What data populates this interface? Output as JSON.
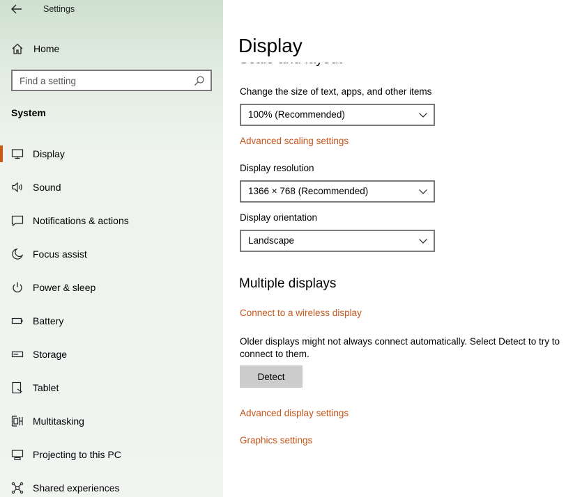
{
  "window": {
    "title": "Settings",
    "back_icon": "back-arrow-icon"
  },
  "sidebar": {
    "home": {
      "label": "Home",
      "icon": "home-icon"
    },
    "search": {
      "placeholder": "Find a setting",
      "icon": "search-icon"
    },
    "section_heading": "System",
    "accent_color": "#c85a15",
    "items": [
      {
        "label": "Display",
        "icon": "monitor-icon",
        "selected": true
      },
      {
        "label": "Sound",
        "icon": "speaker-icon",
        "selected": false
      },
      {
        "label": "Notifications & actions",
        "icon": "notification-icon",
        "selected": false
      },
      {
        "label": "Focus assist",
        "icon": "moon-icon",
        "selected": false
      },
      {
        "label": "Power & sleep",
        "icon": "power-icon",
        "selected": false
      },
      {
        "label": "Battery",
        "icon": "battery-icon",
        "selected": false
      },
      {
        "label": "Storage",
        "icon": "storage-icon",
        "selected": false
      },
      {
        "label": "Tablet",
        "icon": "tablet-icon",
        "selected": false
      },
      {
        "label": "Multitasking",
        "icon": "multitasking-icon",
        "selected": false
      },
      {
        "label": "Projecting to this PC",
        "icon": "projecting-icon",
        "selected": false
      },
      {
        "label": "Shared experiences",
        "icon": "shared-icon",
        "selected": false
      }
    ]
  },
  "main": {
    "title": "Display",
    "scale_heading": "Scale and layout",
    "scale_label": "Change the size of text, apps, and other items",
    "scale_value": "100% (Recommended)",
    "advanced_scaling_link": "Advanced scaling settings",
    "resolution_label": "Display resolution",
    "resolution_value": "1366 × 768 (Recommended)",
    "orientation_label": "Display orientation",
    "orientation_value": "Landscape",
    "multiple_heading": "Multiple displays",
    "wireless_link": "Connect to a wireless display",
    "older_text": "Older displays might not always connect automatically. Select Detect to try to connect to them.",
    "detect_button": "Detect",
    "advanced_display_link": "Advanced display settings",
    "graphics_link": "Graphics settings",
    "link_color": "#c3541a"
  }
}
